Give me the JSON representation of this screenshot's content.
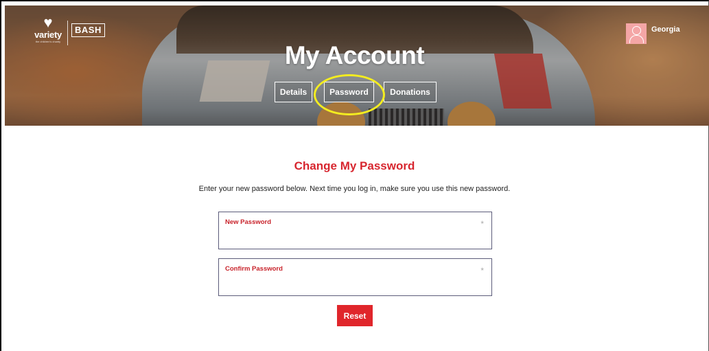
{
  "brand": {
    "logo_name": "variety",
    "logo_sub": "the children's charity",
    "event_label": "BASH"
  },
  "user": {
    "name": "Georgia"
  },
  "header": {
    "title": "My Account"
  },
  "tabs": [
    {
      "label": "Details"
    },
    {
      "label": "Password"
    },
    {
      "label": "Donations"
    }
  ],
  "form": {
    "title": "Change My Password",
    "instructions": "Enter your new password below. Next time you log in, make sure you use this new password.",
    "new_password": {
      "label": "New Password",
      "required_mark": "*",
      "value": ""
    },
    "confirm_password": {
      "label": "Confirm Password",
      "required_mark": "*",
      "value": ""
    },
    "submit_label": "Reset"
  },
  "colors": {
    "accent": "#d7262f",
    "button": "#e0262b",
    "highlight": "#f3ec20",
    "avatar": "#f4a6a6"
  },
  "icons": {
    "logo": "variety-heart-icon",
    "avatar": "user-avatar-icon"
  }
}
